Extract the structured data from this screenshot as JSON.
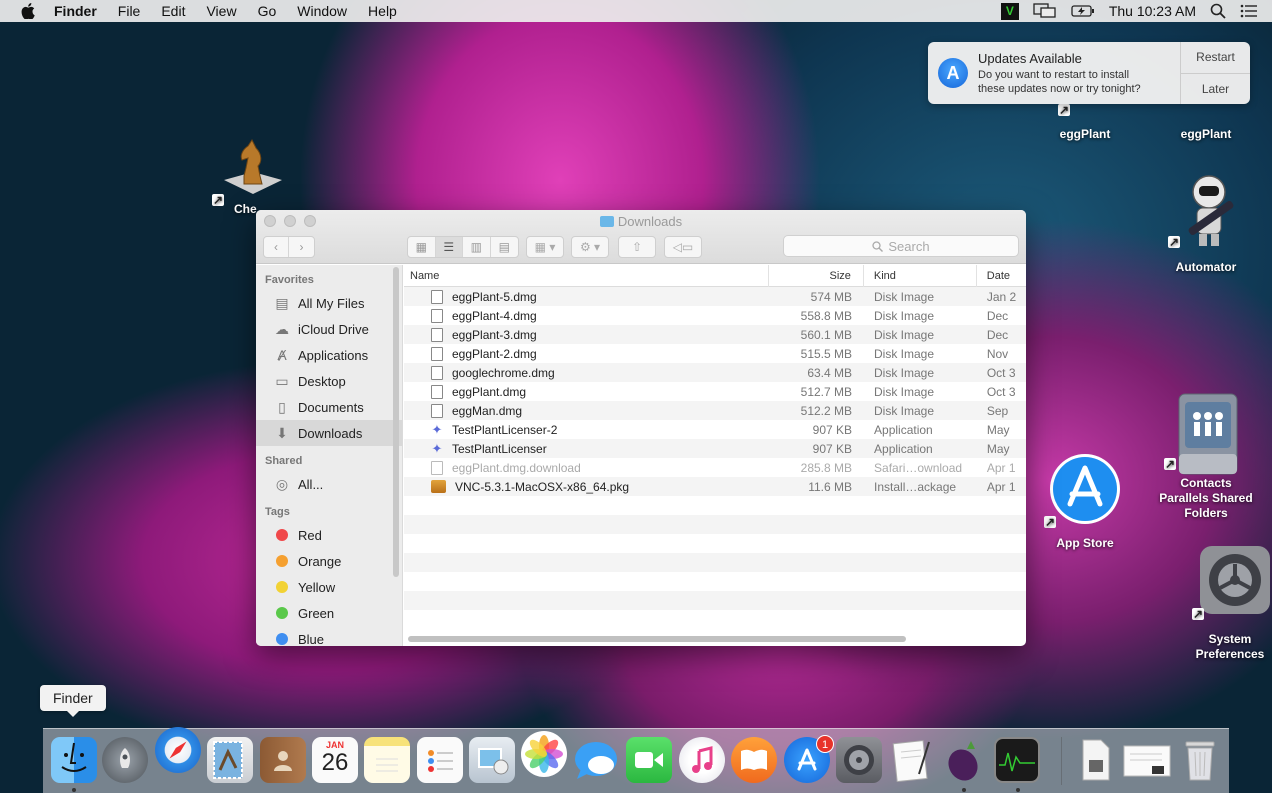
{
  "menubar": {
    "apple": "",
    "items": [
      "Finder",
      "File",
      "Edit",
      "View",
      "Go",
      "Window",
      "Help"
    ],
    "clock": "Thu 10:23 AM",
    "vnc_label": "V"
  },
  "notification": {
    "title": "Updates Available",
    "body_line1": "Do you want to restart to install",
    "body_line2": "these updates now or try tonight?",
    "restart": "Restart",
    "later": "Later",
    "icon_letter": "A"
  },
  "desktop": {
    "chess_label": "Che",
    "eggplant1": "eggPlant",
    "eggplant2": "eggPlant",
    "automator": "Automator",
    "app_store": "App Store",
    "contacts_line1": "Contacts",
    "contacts_line2": "Parallels Shared",
    "contacts_line3": "Folders",
    "sysprefs_line1": "System",
    "sysprefs_line2": "Preferences"
  },
  "finder": {
    "title": "Downloads",
    "search_placeholder": "Search",
    "sidebar": {
      "favorites_header": "Favorites",
      "favorites": [
        "All My Files",
        "iCloud Drive",
        "Applications",
        "Desktop",
        "Documents",
        "Downloads"
      ],
      "shared_header": "Shared",
      "shared": [
        "All..."
      ],
      "tags_header": "Tags",
      "tags": [
        {
          "label": "Red",
          "color": "#f0484a"
        },
        {
          "label": "Orange",
          "color": "#f5a030"
        },
        {
          "label": "Yellow",
          "color": "#f2d234"
        },
        {
          "label": "Green",
          "color": "#5ac84a"
        },
        {
          "label": "Blue",
          "color": "#3f8ef0"
        }
      ]
    },
    "columns": {
      "name": "Name",
      "size": "Size",
      "kind": "Kind",
      "date": "Date"
    },
    "rows": [
      {
        "name": "eggPlant-5.dmg",
        "size": "574 MB",
        "kind": "Disk Image",
        "date": "Jan 2"
      },
      {
        "name": "eggPlant-4.dmg",
        "size": "558.8 MB",
        "kind": "Disk Image",
        "date": "Dec"
      },
      {
        "name": "eggPlant-3.dmg",
        "size": "560.1 MB",
        "kind": "Disk Image",
        "date": "Dec"
      },
      {
        "name": "eggPlant-2.dmg",
        "size": "515.5 MB",
        "kind": "Disk Image",
        "date": "Nov"
      },
      {
        "name": "googlechrome.dmg",
        "size": "63.4 MB",
        "kind": "Disk Image",
        "date": "Oct 3"
      },
      {
        "name": "eggPlant.dmg",
        "size": "512.7 MB",
        "kind": "Disk Image",
        "date": "Oct 3"
      },
      {
        "name": "eggMan.dmg",
        "size": "512.2 MB",
        "kind": "Disk Image",
        "date": "Sep"
      },
      {
        "name": "TestPlantLicenser-2",
        "size": "907 KB",
        "kind": "Application",
        "date": "May"
      },
      {
        "name": "TestPlantLicenser",
        "size": "907 KB",
        "kind": "Application",
        "date": "May"
      },
      {
        "name": "eggPlant.dmg.download",
        "size": "285.8 MB",
        "kind": "Safari…ownload",
        "date": "Apr 1"
      },
      {
        "name": "VNC-5.3.1-MacOSX-x86_64.pkg",
        "size": "11.6 MB",
        "kind": "Install…ackage",
        "date": "Apr 1"
      }
    ]
  },
  "dock": {
    "tooltip": "Finder",
    "calendar_month": "JAN",
    "calendar_day": "26",
    "app_store_badge": "1"
  },
  "colors": {
    "accent": "#1f7ae0",
    "badge": "#e8332a"
  }
}
